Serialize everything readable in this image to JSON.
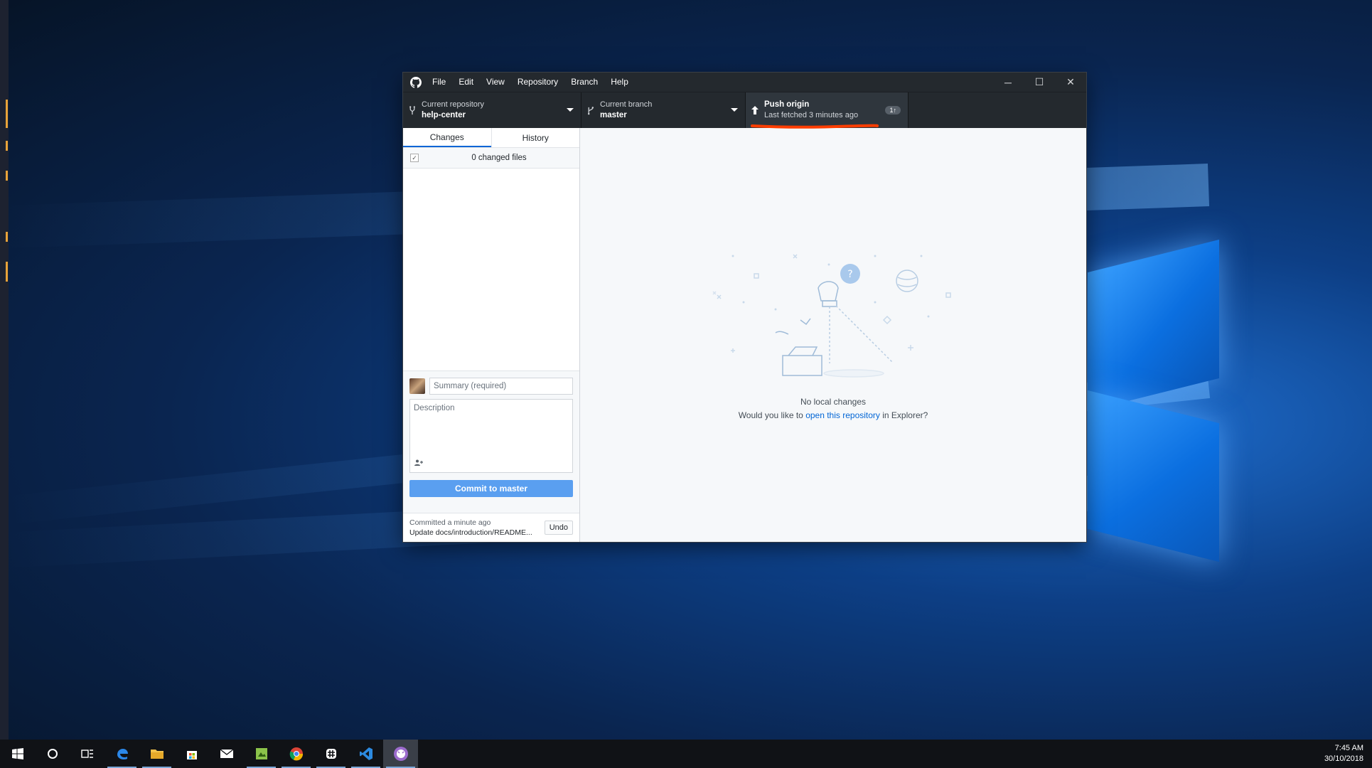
{
  "window": {
    "menu": [
      "File",
      "Edit",
      "View",
      "Repository",
      "Branch",
      "Help"
    ],
    "controls": {
      "minimize": "─",
      "maximize": "☐",
      "close": "✕"
    }
  },
  "toolbar": {
    "repo": {
      "label": "Current repository",
      "value": "help-center"
    },
    "branch": {
      "label": "Current branch",
      "value": "master"
    },
    "push": {
      "label": "Push origin",
      "sub": "Last fetched 3 minutes ago",
      "badge": "1↑"
    }
  },
  "sidebar": {
    "tabs": [
      "Changes",
      "History"
    ],
    "changed_files": "0 changed files",
    "summary_placeholder": "Summary (required)",
    "description_placeholder": "Description",
    "commit_button": "Commit to master",
    "last_commit": {
      "time": "Committed a minute ago",
      "message": "Update docs/introduction/README...",
      "undo": "Undo"
    }
  },
  "main": {
    "title": "No local changes",
    "prompt_pre": "Would you like to ",
    "prompt_link": "open this repository",
    "prompt_post": " in Explorer?"
  },
  "taskbar": {
    "time": "7:45 AM",
    "date": "30/10/2018",
    "apps": [
      "start-icon",
      "cortana-icon",
      "task-view-icon",
      "edge-icon",
      "file-explorer-icon",
      "store-icon",
      "mail-icon",
      "app-icon",
      "chrome-icon",
      "slack-icon",
      "vscode-icon",
      "github-desktop-icon"
    ]
  },
  "colors": {
    "accent": "#0366d6",
    "commit_button": "#5a9ff0",
    "titlebar": "#24292e",
    "highlight": "#ff3d00"
  }
}
